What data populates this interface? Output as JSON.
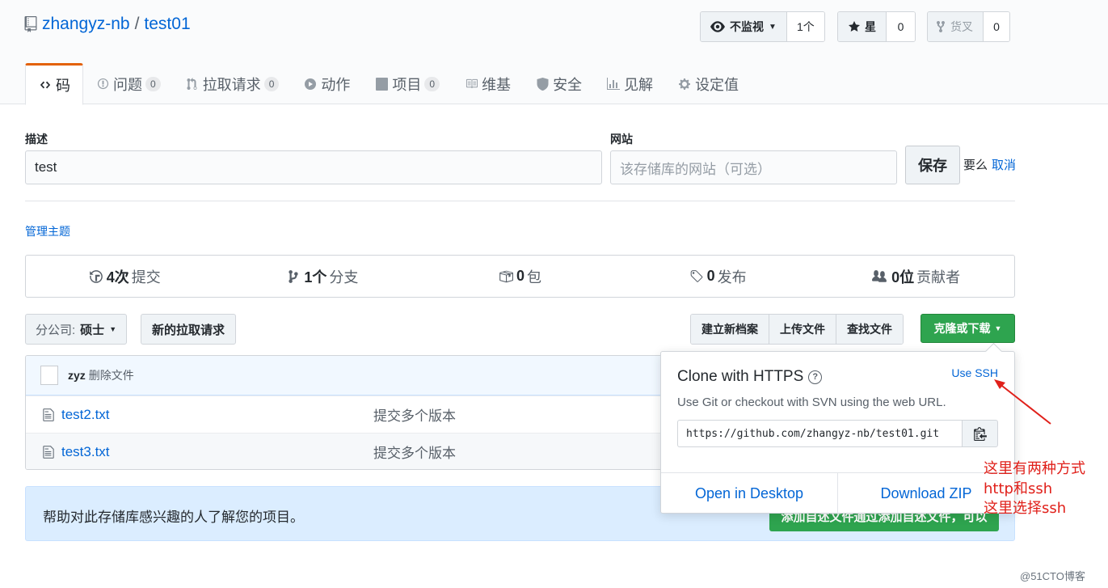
{
  "repo": {
    "owner": "zhangyz-nb",
    "separator": "/",
    "name": "test01"
  },
  "actions": {
    "watch": {
      "label": "不监视",
      "count": "1个"
    },
    "star": {
      "label": "星",
      "count": "0"
    },
    "fork": {
      "label": "货叉",
      "count": "0"
    }
  },
  "tabs": [
    {
      "label": "码",
      "counter": ""
    },
    {
      "label": "问题",
      "counter": "0"
    },
    {
      "label": "拉取请求",
      "counter": "0"
    },
    {
      "label": "动作",
      "counter": ""
    },
    {
      "label": "项目",
      "counter": "0"
    },
    {
      "label": "维基",
      "counter": ""
    },
    {
      "label": "安全",
      "counter": ""
    },
    {
      "label": "见解",
      "counter": ""
    },
    {
      "label": "设定值",
      "counter": ""
    }
  ],
  "edit": {
    "description_label": "描述",
    "description_value": "test",
    "website_label": "网站",
    "website_placeholder": "该存储库的网站（可选）",
    "save_label": "保存",
    "or_text": "要么",
    "cancel_label": "取消"
  },
  "manage_topics": "管理主题",
  "summary": {
    "commits": {
      "num": "4次",
      "label": "提交"
    },
    "branches": {
      "num": "1个",
      "label": "分支"
    },
    "packages": {
      "num": "0",
      "label": "包"
    },
    "releases": {
      "num": "0",
      "label": "发布"
    },
    "contributors": {
      "num": "0位",
      "label": "贡献者"
    }
  },
  "branch": {
    "prefix": "分公司:",
    "name": "硕士"
  },
  "new_pr_label": "新的拉取请求",
  "file_nav": {
    "create": "建立新档案",
    "upload": "上传文件",
    "find": "查找文件"
  },
  "clone_button": "克隆或下载",
  "commit": {
    "author": "zyz",
    "message": "删除文件"
  },
  "files": [
    {
      "name": "test2.txt",
      "message": "提交多个版本"
    },
    {
      "name": "test3.txt",
      "message": "提交多个版本"
    }
  ],
  "readme": {
    "text": "帮助对此存储库感兴趣的人了解您的项目。",
    "button": "添加自述文件通过添加自述文件，可以"
  },
  "clone_dropdown": {
    "title": "Clone with HTTPS",
    "use_ssh": "Use SSH",
    "description": "Use Git or checkout with SVN using the web URL.",
    "url": "https://github.com/zhangyz-nb/test01.git",
    "open_desktop": "Open in Desktop",
    "download_zip": "Download ZIP"
  },
  "annotation": {
    "line1": "这里有两种方式",
    "line2": "http和ssh",
    "line3": "这里选择ssh"
  },
  "watermark": "@51CTO博客",
  "colors": {
    "link": "#0366d6",
    "green": "#2ea44f",
    "tab_accent": "#e36209",
    "annotation": "#e0201a"
  }
}
